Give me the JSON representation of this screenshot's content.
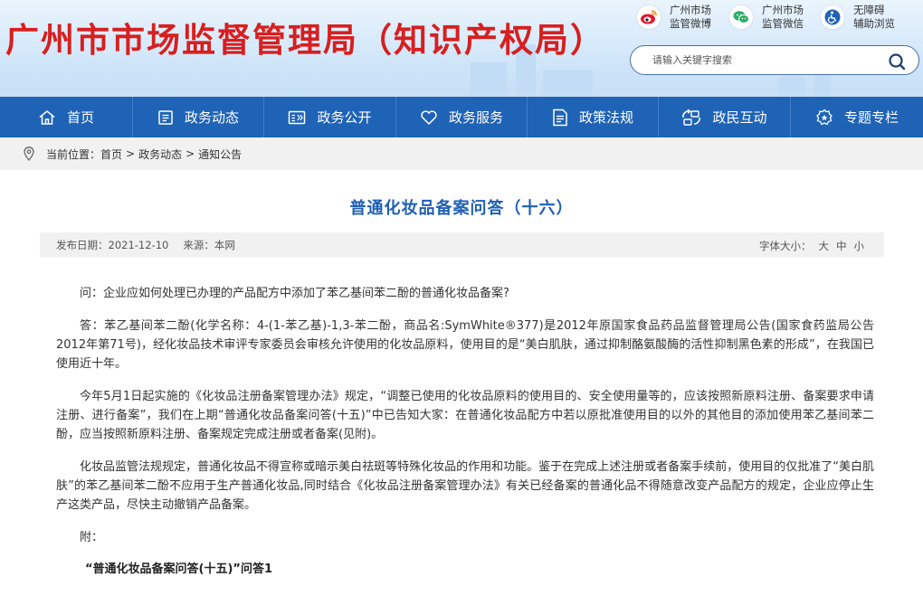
{
  "header": {
    "site_title": "广州市市场监督管理局（知识产权局）",
    "weibo": {
      "line1": "广州市场",
      "line2": "监管微博"
    },
    "wechat": {
      "line1": "广州市场",
      "line2": "监管微信"
    },
    "accessibility": {
      "line1": "无障碍",
      "line2": "辅助浏览"
    },
    "search_placeholder": "请输入关键字搜索"
  },
  "nav": {
    "items": [
      {
        "label": "首页",
        "icon": "home-icon"
      },
      {
        "label": "政务动态",
        "icon": "news-icon"
      },
      {
        "label": "政务公开",
        "icon": "disclosure-icon"
      },
      {
        "label": "政务服务",
        "icon": "heart-icon"
      },
      {
        "label": "政策法规",
        "icon": "document-icon"
      },
      {
        "label": "政民互动",
        "icon": "interaction-icon"
      },
      {
        "label": "专题专栏",
        "icon": "badge-icon"
      }
    ]
  },
  "breadcrumb": {
    "prefix": "当前位置：",
    "items": [
      "首页",
      "政务动态",
      "通知公告"
    ],
    "separator": ">"
  },
  "article": {
    "title": "普通化妆品备案问答（十六）",
    "date_label": "发布日期：",
    "date": "2021-12-10",
    "source_label": "来源：",
    "source": "本网",
    "font_size_label": "字体大小：",
    "font_sizes": [
      "大",
      "中",
      "小"
    ],
    "paragraphs": [
      "问：企业应如何处理已办理的产品配方中添加了苯乙基间苯二酚的普通化妆品备案?",
      "答：苯乙基间苯二酚(化学名称：4-(1-苯乙基)-1,3-苯二酚，商品名:SymWhite®377)是2012年原国家食品药品监督管理局公告(国家食药监局公告2012年第71号)，经化妆品技术审评专家委员会审核允许使用的化妆品原料，使用目的是“美白肌肤，通过抑制酪氨酸酶的活性抑制黑色素的形成”，在我国已使用近十年。",
      "今年5月1日起实施的《化妆品注册备案管理办法》规定，“调整已使用的化妆品原料的使用目的、安全使用量等的，应该按照新原料注册、备案要求申请注册、进行备案”，我们在上期“普通化妆品备案问答(十五)”中已告知大家：在普通化妆品配方中若以原批准使用目的以外的其他目的添加使用苯乙基间苯二酚，应当按照新原料注册、备案规定完成注册或者备案(见附)。",
      "化妆品监管法规规定，普通化妆品不得宣称或暗示美白祛斑等特殊化妆品的作用和功能。鉴于在完成上述注册或者备案手续前，使用目的仅批准了“美白肌肤”的苯乙基间苯二酚不应用于生产普通化妆品,同时结合《化妆品注册备案管理办法》有关已经备案的普通化品不得随意改变产品配方的规定，企业应停止生产这类产品，尽快主动撤销产品备案。"
    ],
    "attachment_label": "附：",
    "sub_heading": "“普通化妆品备案问答(十五)”问答1"
  },
  "colors": {
    "title_red": "#d71f1f",
    "nav_blue": "#1f63b6",
    "article_title_blue": "#1f5fb3"
  }
}
